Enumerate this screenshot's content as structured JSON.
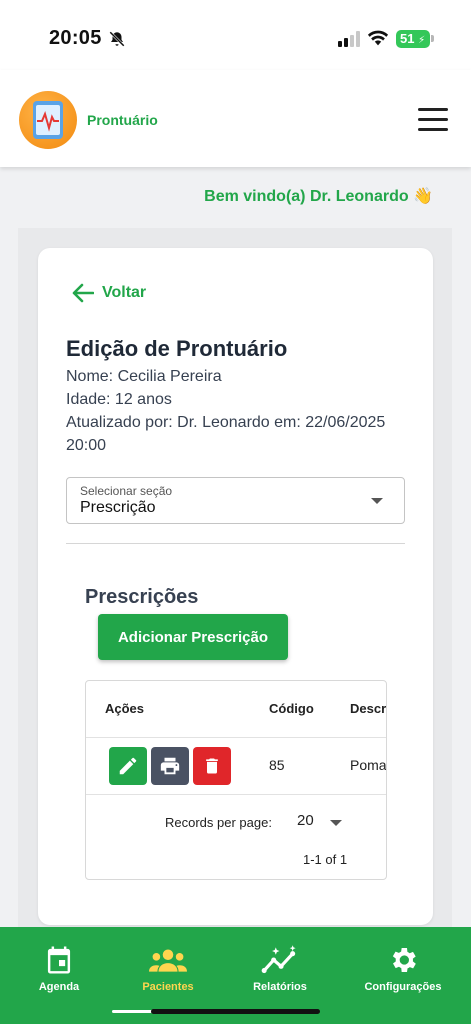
{
  "status_bar": {
    "time": "20:05",
    "battery": "51"
  },
  "header": {
    "title": "Prontuário"
  },
  "welcome": "Bem vindo(a) Dr. Leonardo 👋",
  "card": {
    "back_label": "Voltar",
    "title": "Edição de Prontuário",
    "patient_name": "Nome: Cecilia Pereira",
    "patient_age": "Idade: 12 anos",
    "updated_info": "Atualizado por: Dr. Leonardo em: 22/06/2025 20:00",
    "section_select": {
      "label": "Selecionar seção",
      "value": "Prescrição"
    }
  },
  "prescriptions": {
    "title": "Prescrições",
    "add_button": "Adicionar Prescrição",
    "columns": [
      "Ações",
      "Código",
      "Descr"
    ],
    "rows": [
      {
        "code": "85",
        "description": "Poma"
      }
    ],
    "records_per_page_label": "Records per page:",
    "records_per_page": "20",
    "range": "1-1 of 1"
  },
  "bottom_nav": {
    "items": [
      {
        "label": "Agenda",
        "icon": "calendar-icon"
      },
      {
        "label": "Pacientes",
        "icon": "people-icon"
      },
      {
        "label": "Relatórios",
        "icon": "chart-icon"
      },
      {
        "label": "Configurações",
        "icon": "gear-icon"
      }
    ],
    "active": "Pacientes"
  },
  "colors": {
    "accent": "#22a64a",
    "active_nav": "#ffd54f",
    "delete": "#e0262a",
    "print": "#4a5263"
  }
}
